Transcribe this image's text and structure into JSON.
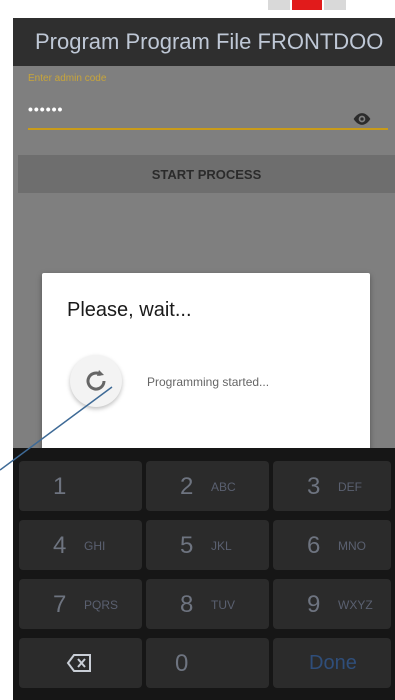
{
  "app": {
    "title": "Program Program File FRONTDOO..."
  },
  "form": {
    "admin_code_label": "Enter admin code",
    "admin_code_value": "••••••",
    "start_button_label": "START PROCESS"
  },
  "dialog": {
    "title": "Please, wait...",
    "message": "Programming started..."
  },
  "keyboard": {
    "keys": [
      {
        "num": "1",
        "letters": ""
      },
      {
        "num": "2",
        "letters": "ABC"
      },
      {
        "num": "3",
        "letters": "DEF"
      },
      {
        "num": "4",
        "letters": "GHI"
      },
      {
        "num": "5",
        "letters": "JKL"
      },
      {
        "num": "6",
        "letters": "MNO"
      },
      {
        "num": "7",
        "letters": "PQRS"
      },
      {
        "num": "8",
        "letters": "TUV"
      },
      {
        "num": "9",
        "letters": "WXYZ"
      }
    ],
    "zero": "0",
    "done_label": "Done"
  },
  "icons": {
    "visibility": "eye-icon",
    "spinner": "refresh-icon",
    "backspace": "backspace-icon"
  },
  "colors": {
    "appbar": "#2f2f2f",
    "accent_underline": "#c89b1a",
    "done": "#2f4e7a",
    "status_red": "#e11b1b"
  }
}
